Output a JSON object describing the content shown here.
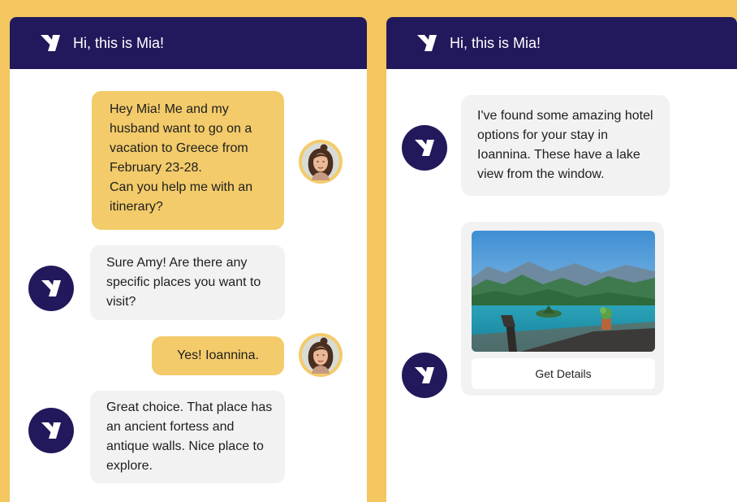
{
  "left_panel": {
    "header_title": "Hi, this is Mia!",
    "messages": [
      {
        "sender": "user",
        "text": "Hey Mia! Me and my husband want to go on a vacation to Greece from February 23-28.\nCan you help me with an itinerary?"
      },
      {
        "sender": "bot",
        "text": "Sure Amy! Are there any specific places you want to visit?"
      },
      {
        "sender": "user",
        "text": "Yes! Ioannina."
      },
      {
        "sender": "bot",
        "text": "Great choice. That place has an ancient fortess and antique walls. Nice place to explore."
      }
    ]
  },
  "right_panel": {
    "header_title": "Hi, this is Mia!",
    "messages": [
      {
        "sender": "bot",
        "text": "I've found some amazing hotel options for your stay in Ioannina. These have a lake view from the window."
      }
    ],
    "hotel_card": {
      "button_label": "Get Details",
      "image": "lake-view-hotel-photo"
    }
  },
  "colors": {
    "brand_navy": "#22195c",
    "accent_yellow": "#f3cb6a",
    "bot_bubble": "#f2f2f2"
  },
  "icons": {
    "brand_logo": "mia-logo-icon",
    "user_avatar": "amy-avatar"
  }
}
